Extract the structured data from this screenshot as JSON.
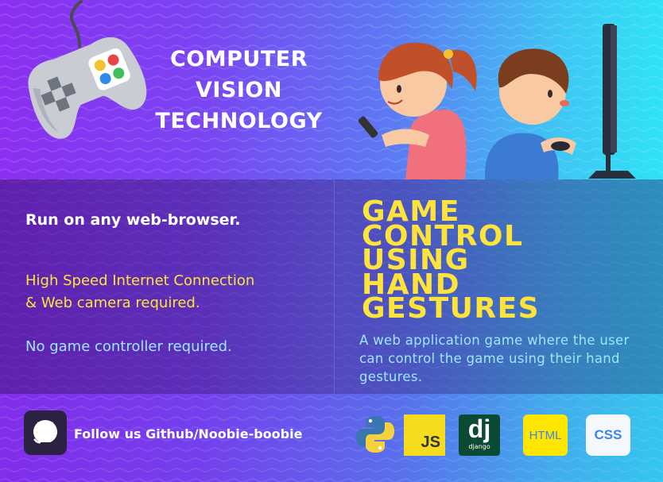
{
  "header": {
    "title_lines": [
      "COMPUTER",
      "VISION",
      "TECHNOLOGY"
    ]
  },
  "left_panel": {
    "browser_text": "Run on any web-browser.",
    "requirements_lines": [
      "High Speed Internet Connection",
      "& Web camera required."
    ],
    "no_controller_text": "No game controller required."
  },
  "right_panel": {
    "headline_lines": [
      "GAME",
      "CONTROL",
      "USING",
      "HAND",
      "GESTURES"
    ],
    "description": "A web application game where the user can control the game using their hand gestures."
  },
  "footer": {
    "follow_text": "Follow us Github/Noobie-boobie",
    "logos": {
      "js": "JS",
      "django": "dj",
      "django_small": "django",
      "html": "HTML",
      "css": "CSS"
    }
  },
  "colors": {
    "accent_yellow": "#ffe33d",
    "accent_blue": "#9ee6ff",
    "bg_left": "#8b2ff0",
    "bg_right": "#2fe2f6"
  },
  "icons": [
    "gamepad-icon",
    "github-icon",
    "python-icon",
    "javascript-icon",
    "django-icon",
    "html-icon",
    "css-icon"
  ]
}
